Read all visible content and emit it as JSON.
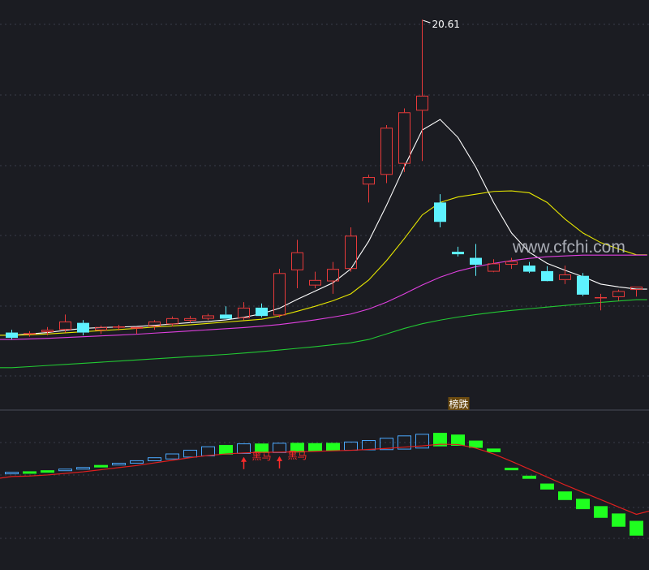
{
  "watermark": "www.cfchi.com",
  "colors": {
    "background": "#1b1c22",
    "grid": "#3a3d4a",
    "up": "#e83a3a",
    "down": "#5ef2ff",
    "ma5": "#ffffff",
    "ma10": "#e6e600",
    "ma20": "#e040e0",
    "ma60": "#22c833",
    "osc_up": "#4aa8ff",
    "osc_down": "#1fff1f",
    "osc_line": "#e01f1f",
    "signal": "#ff2a2a",
    "badge_bg": "#6a4a10",
    "badge_text": "#ffffff"
  },
  "chart_data": [
    {
      "type": "candlestick",
      "title": "",
      "ylim": [
        6.5,
        21.2
      ],
      "high_label": "20.61",
      "candles": [
        {
          "o": 9.3,
          "h": 9.4,
          "l": 9.05,
          "c": 9.11
        },
        {
          "o": 9.25,
          "h": 9.35,
          "l": 9.15,
          "c": 9.28
        },
        {
          "o": 9.32,
          "h": 9.5,
          "l": 9.2,
          "c": 9.4
        },
        {
          "o": 9.4,
          "h": 9.95,
          "l": 9.3,
          "c": 9.7
        },
        {
          "o": 9.65,
          "h": 9.75,
          "l": 9.2,
          "c": 9.3
        },
        {
          "o": 9.38,
          "h": 9.55,
          "l": 9.25,
          "c": 9.5
        },
        {
          "o": 9.48,
          "h": 9.58,
          "l": 9.38,
          "c": 9.52
        },
        {
          "o": 9.44,
          "h": 9.5,
          "l": 9.25,
          "c": 9.5
        },
        {
          "o": 9.52,
          "h": 9.75,
          "l": 9.4,
          "c": 9.7
        },
        {
          "o": 9.6,
          "h": 9.88,
          "l": 9.52,
          "c": 9.82
        },
        {
          "o": 9.73,
          "h": 9.9,
          "l": 9.65,
          "c": 9.82
        },
        {
          "o": 9.8,
          "h": 9.98,
          "l": 9.75,
          "c": 9.92
        },
        {
          "o": 9.95,
          "h": 10.25,
          "l": 9.82,
          "c": 9.8
        },
        {
          "o": 9.82,
          "h": 10.4,
          "l": 9.75,
          "c": 10.2
        },
        {
          "o": 10.2,
          "h": 10.35,
          "l": 9.85,
          "c": 9.9
        },
        {
          "o": 9.92,
          "h": 11.6,
          "l": 9.85,
          "c": 11.45
        },
        {
          "o": 11.55,
          "h": 12.65,
          "l": 10.9,
          "c": 12.2
        },
        {
          "o": 11.0,
          "h": 11.5,
          "l": 10.9,
          "c": 11.2
        },
        {
          "o": 11.15,
          "h": 11.85,
          "l": 10.7,
          "c": 11.6
        },
        {
          "o": 11.6,
          "h": 13.1,
          "l": 11.5,
          "c": 12.8
        },
        {
          "o": 14.65,
          "h": 15.0,
          "l": 14.0,
          "c": 14.92
        },
        {
          "o": 15.0,
          "h": 16.8,
          "l": 14.7,
          "c": 16.7
        },
        {
          "o": 15.4,
          "h": 17.4,
          "l": 15.1,
          "c": 17.26
        },
        {
          "o": 17.32,
          "h": 20.61,
          "l": 15.5,
          "c": 17.86
        },
        {
          "o": 14.0,
          "h": 14.3,
          "l": 13.1,
          "c": 13.3
        },
        {
          "o": 12.22,
          "h": 12.4,
          "l": 12.05,
          "c": 12.13
        },
        {
          "o": 12.0,
          "h": 12.5,
          "l": 11.35,
          "c": 11.75
        },
        {
          "o": 11.5,
          "h": 11.95,
          "l": 11.48,
          "c": 11.8
        },
        {
          "o": 11.75,
          "h": 12.0,
          "l": 11.6,
          "c": 11.88
        },
        {
          "o": 11.72,
          "h": 11.85,
          "l": 11.45,
          "c": 11.5
        },
        {
          "o": 11.52,
          "h": 11.7,
          "l": 11.15,
          "c": 11.16
        },
        {
          "o": 11.2,
          "h": 11.72,
          "l": 11.05,
          "c": 11.4
        },
        {
          "o": 11.35,
          "h": 11.45,
          "l": 10.62,
          "c": 10.67
        },
        {
          "o": 10.55,
          "h": 10.7,
          "l": 10.1,
          "c": 10.58
        },
        {
          "o": 10.58,
          "h": 10.85,
          "l": 10.45,
          "c": 10.8
        },
        {
          "o": 10.84,
          "h": 10.96,
          "l": 10.6,
          "c": 10.96
        }
      ],
      "series": [
        {
          "values": [
            9.2,
            9.25,
            9.3,
            9.38,
            9.45,
            9.48,
            9.5,
            9.52,
            9.56,
            9.61,
            9.66,
            9.7,
            9.76,
            9.85,
            9.98,
            10.18,
            10.5,
            10.8,
            11.1,
            11.6,
            12.6,
            13.9,
            15.3,
            16.62,
            17.0,
            16.35,
            15.28,
            14.0,
            12.9,
            12.2,
            11.8,
            11.55,
            11.32,
            11.05,
            10.95,
            10.87
          ]
        },
        {
          "values": [
            9.2,
            9.22,
            9.25,
            9.29,
            9.33,
            9.37,
            9.41,
            9.45,
            9.5,
            9.54,
            9.58,
            9.63,
            9.68,
            9.73,
            9.78,
            9.9,
            10.07,
            10.25,
            10.45,
            10.7,
            11.2,
            11.9,
            12.7,
            13.55,
            14.0,
            14.2,
            14.3,
            14.4,
            14.42,
            14.35,
            14.0,
            13.4,
            12.9,
            12.55,
            12.32,
            12.11
          ]
        },
        {
          "values": [
            9.05,
            9.07,
            9.09,
            9.12,
            9.15,
            9.18,
            9.21,
            9.24,
            9.28,
            9.32,
            9.36,
            9.4,
            9.44,
            9.48,
            9.53,
            9.59,
            9.67,
            9.76,
            9.86,
            9.97,
            10.15,
            10.4,
            10.7,
            11.02,
            11.3,
            11.52,
            11.68,
            11.8,
            11.9,
            11.98,
            12.04,
            12.07,
            12.1,
            12.1,
            12.1,
            12.1
          ]
        },
        {
          "values": [
            8.03,
            8.07,
            8.11,
            8.15,
            8.19,
            8.23,
            8.27,
            8.31,
            8.35,
            8.39,
            8.43,
            8.47,
            8.51,
            8.56,
            8.61,
            8.67,
            8.73,
            8.79,
            8.86,
            8.93,
            9.05,
            9.25,
            9.45,
            9.62,
            9.75,
            9.86,
            9.95,
            10.03,
            10.1,
            10.16,
            10.22,
            10.28,
            10.34,
            10.39,
            10.44,
            10.49
          ]
        }
      ]
    },
    {
      "type": "bar",
      "title": "",
      "values": [
        0.6,
        0.4,
        0.3,
        0.45,
        0.9,
        0.85,
        1.0,
        1.25,
        1.5,
        2.25,
        2.95,
        3.8,
        3.7,
        4.0,
        3.6,
        3.9,
        3.7,
        3.2,
        3.0,
        3.5,
        3.9,
        4.7,
        5.4,
        5.6,
        5.2,
        4.3,
        2.8,
        1.4,
        -0.1,
        -1.2,
        -2.3,
        -3.3,
        -4.0,
        -4.5,
        -5.1,
        -5.7
      ],
      "osc_series": [
        1.4,
        1.45,
        1.55,
        1.7,
        1.85,
        2.05,
        2.25,
        2.45,
        2.7,
        2.95,
        3.2,
        3.4,
        3.55,
        3.65,
        3.7,
        3.72,
        3.75,
        3.8,
        3.85,
        3.9,
        3.98,
        4.08,
        4.2,
        4.32,
        4.48,
        4.45,
        4.1,
        3.55,
        2.85,
        2.1,
        1.35,
        0.6,
        -0.1,
        -0.8,
        -1.5,
        -2.2
      ],
      "ylim": [
        -7.5,
        7.5
      ],
      "annotations": [
        {
          "index": 13,
          "label": "黑马"
        },
        {
          "index": 15,
          "label": "黑马"
        }
      ],
      "badge": {
        "index": 25,
        "label": "榜跌"
      }
    }
  ]
}
